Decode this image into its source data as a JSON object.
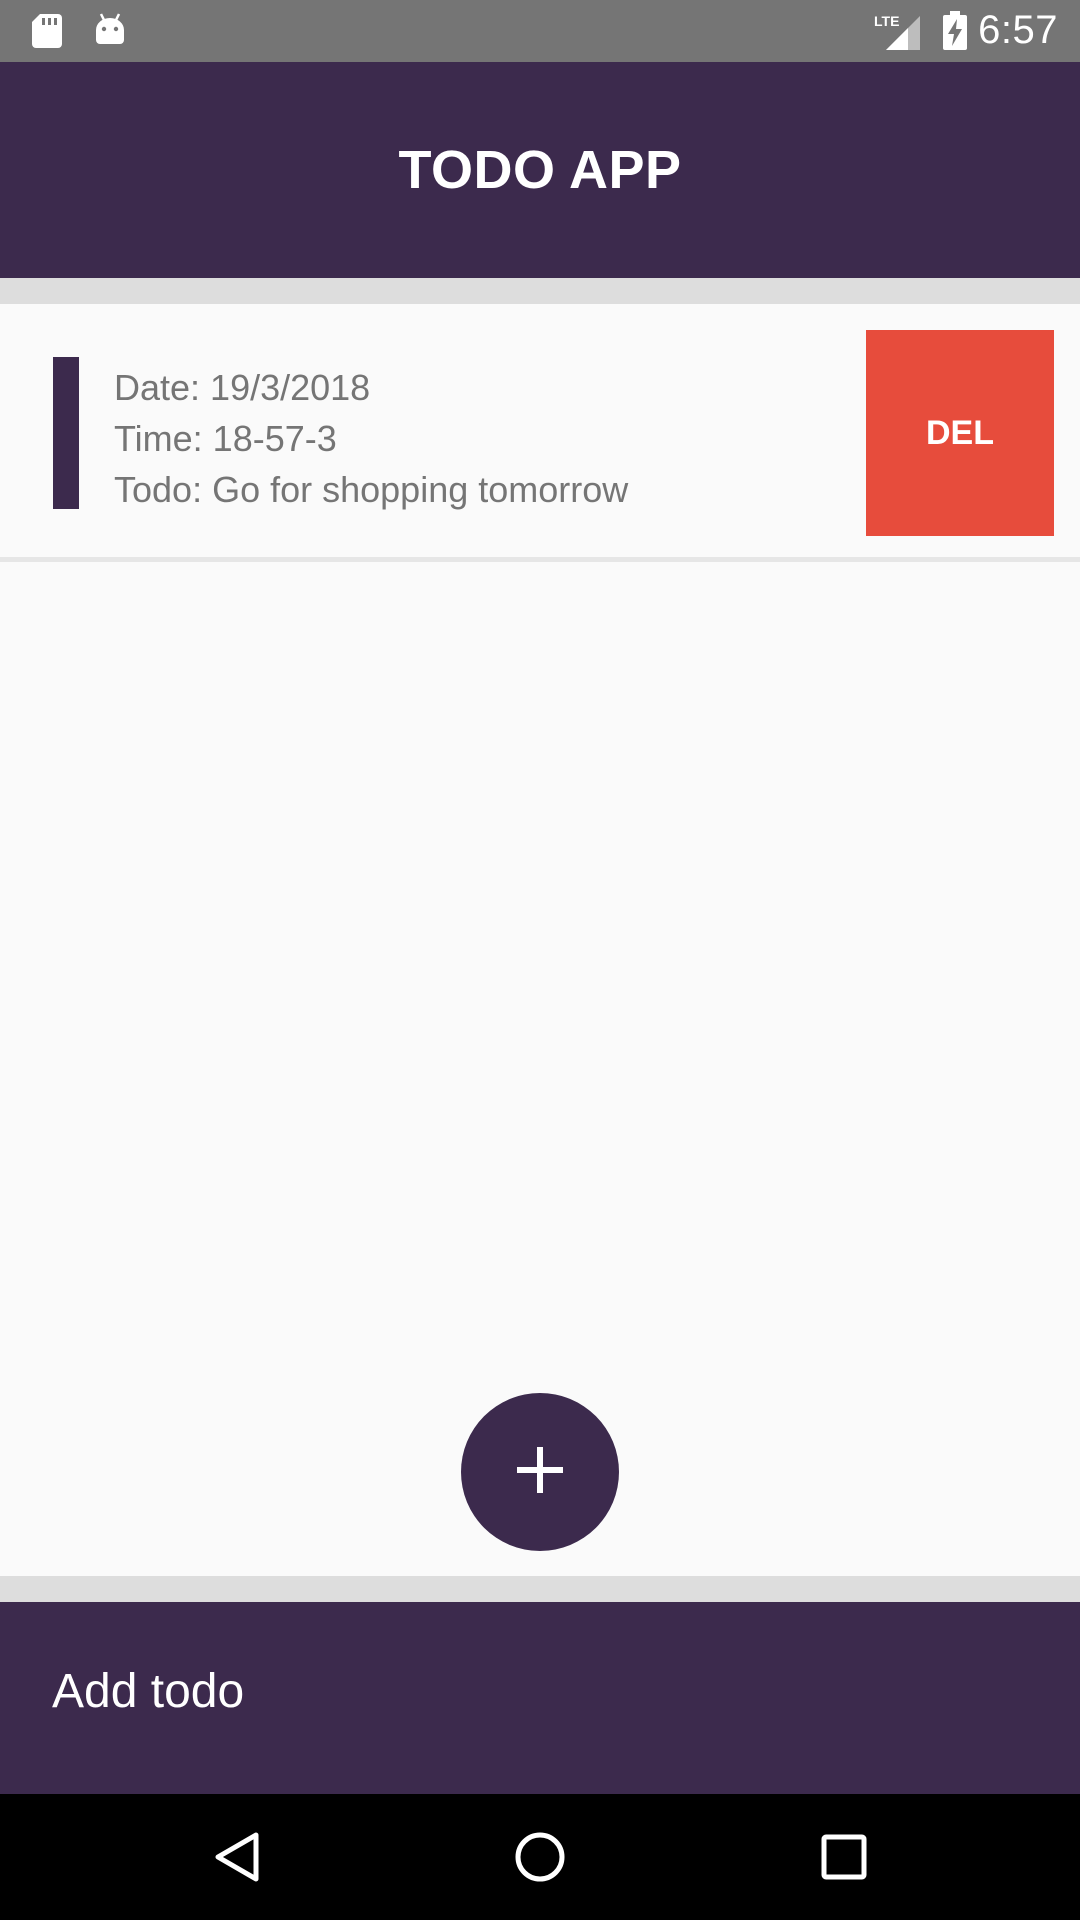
{
  "status_bar": {
    "time": "6:57",
    "network": "LTE",
    "icons": [
      "sd-card-icon",
      "android-icon",
      "lte-signal-icon",
      "battery-charging-icon"
    ]
  },
  "app_bar": {
    "title": "TODO APP"
  },
  "todos": [
    {
      "date_line": "Date: 19/3/2018",
      "time_line": "Time: 18-57-3",
      "todo_line": "Todo: Go for shopping tomorrow",
      "delete_label": "DEL"
    }
  ],
  "fab": {
    "icon": "plus-icon"
  },
  "bottom_bar": {
    "label": "Add todo"
  },
  "nav_bar": {
    "icons": [
      "back-icon",
      "home-icon",
      "recents-icon"
    ]
  },
  "colors": {
    "primary": "#3c2a4d",
    "delete": "#e74c3c",
    "status_bar": "#757575",
    "background": "#fafafa",
    "text_secondary": "#757575"
  }
}
